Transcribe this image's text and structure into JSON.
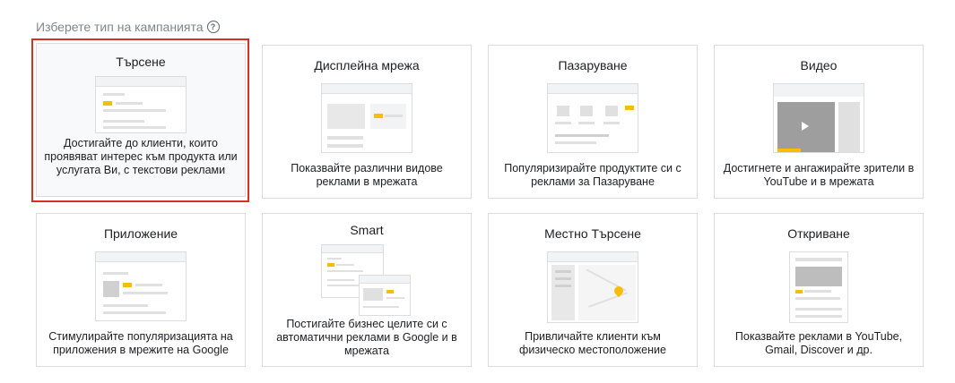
{
  "page": {
    "heading": "Изберете тип на кампанията",
    "help_icon": "help-circle-icon",
    "help_glyph": "?"
  },
  "colors": {
    "accent": "#fbbc04",
    "selection": "#d93025",
    "border": "#dadce0",
    "muted": "#80868b"
  },
  "cards": [
    {
      "title": "Търсене",
      "description": "Достигайте до клиенти, които проявяват интерес към продукта или услугата Ви, с текстови реклами",
      "selected": true
    },
    {
      "title": "Дисплейна мрежа",
      "description": "Показвайте различни видове реклами в мрежата",
      "selected": false
    },
    {
      "title": "Пазаруване",
      "description": "Популяризирайте продуктите си с реклами за Пазаруване",
      "selected": false
    },
    {
      "title": "Видео",
      "description": "Достигнете и ангажирайте зрители в YouTube и в мрежата",
      "selected": false
    },
    {
      "title": "Приложение",
      "description": "Стимулирайте популяризацията на приложения в мрежите на Google",
      "selected": false
    },
    {
      "title": "Smart",
      "description": "Постигайте бизнес целите си с автоматични реклами в Google и в мрежата",
      "selected": false
    },
    {
      "title": "Местно Търсене",
      "description": "Привличайте клиенти към физическо местоположение",
      "selected": false
    },
    {
      "title": "Откриване",
      "description": "Показвайте реклами в YouTube, Gmail, Discover и др.",
      "selected": false
    }
  ]
}
